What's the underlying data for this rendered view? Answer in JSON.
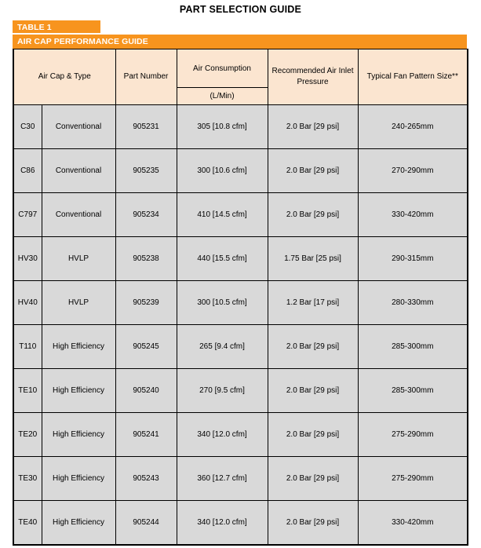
{
  "page": {
    "title": "PART SELECTION GUIDE"
  },
  "banners": {
    "table_label": "TABLE 1",
    "section_title": "AIR CAP PERFORMANCE GUIDE",
    "accent_color": "#F7941E",
    "header_bg": "#FBE5D0",
    "row_bg": "#D9D9D9"
  },
  "table": {
    "headers": {
      "air_cap_type": "Air Cap & Type",
      "part_number": "Part Number",
      "air_consumption": "Air Consumption",
      "air_consumption_unit": "(L/Min)",
      "recommended_pressure": "Recommended Air Inlet Pressure",
      "fan_pattern": "Typical Fan Pattern Size**"
    },
    "rows": [
      {
        "code": "C30",
        "type": "Conventional",
        "part": "905231",
        "air": "305 [10.8 cfm]",
        "pressure": "2.0 Bar [29 psi]",
        "fan": "240-265mm"
      },
      {
        "code": "C86",
        "type": "Conventional",
        "part": "905235",
        "air": "300 [10.6 cfm]",
        "pressure": "2.0 Bar [29 psi]",
        "fan": "270-290mm"
      },
      {
        "code": "C797",
        "type": "Conventional",
        "part": "905234",
        "air": "410 [14.5 cfm]",
        "pressure": "2.0 Bar [29 psi]",
        "fan": "330-420mm"
      },
      {
        "code": "HV30",
        "type": "HVLP",
        "part": "905238",
        "air": "440 [15.5 cfm]",
        "pressure": "1.75 Bar [25 psi]",
        "fan": "290-315mm"
      },
      {
        "code": "HV40",
        "type": "HVLP",
        "part": "905239",
        "air": "300 [10.5 cfm]",
        "pressure": "1.2 Bar [17 psi]",
        "fan": "280-330mm"
      },
      {
        "code": "T110",
        "type": "High Efficiency",
        "part": "905245",
        "air": "265 [9.4 cfm]",
        "pressure": "2.0 Bar [29 psi]",
        "fan": "285-300mm"
      },
      {
        "code": "TE10",
        "type": "High Efficiency",
        "part": "905240",
        "air": "270 [9.5 cfm]",
        "pressure": "2.0 Bar [29 psi]",
        "fan": "285-300mm"
      },
      {
        "code": "TE20",
        "type": "High Efficiency",
        "part": "905241",
        "air": "340 [12.0 cfm]",
        "pressure": "2.0 Bar [29 psi]",
        "fan": "275-290mm"
      },
      {
        "code": "TE30",
        "type": "High Efficiency",
        "part": "905243",
        "air": "360 [12.7 cfm]",
        "pressure": "2.0 Bar [29 psi]",
        "fan": "275-290mm"
      },
      {
        "code": "TE40",
        "type": "High Efficiency",
        "part": "905244",
        "air": "340 [12.0 cfm]",
        "pressure": "2.0 Bar [29 psi]",
        "fan": "330-420mm"
      }
    ]
  }
}
